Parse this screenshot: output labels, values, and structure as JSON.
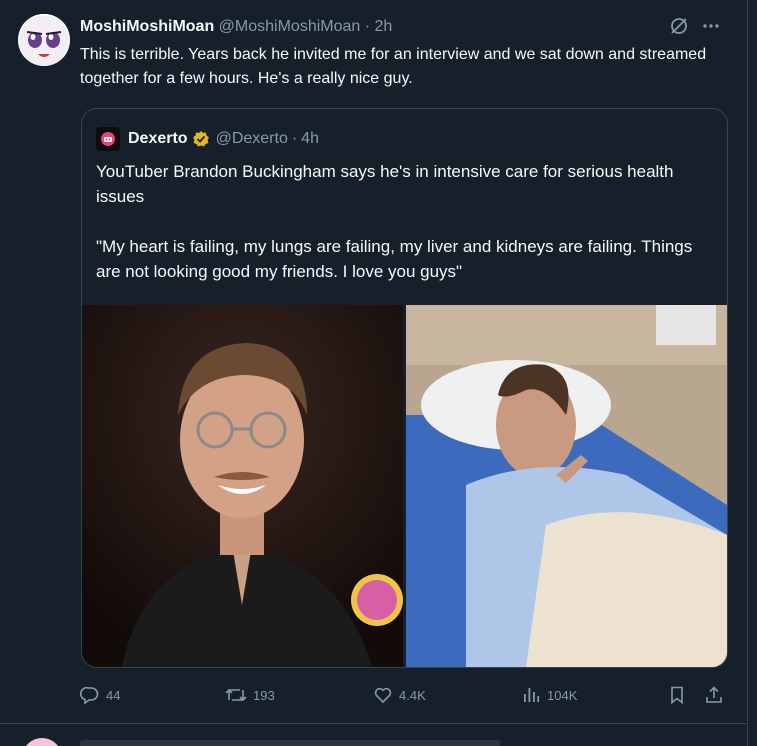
{
  "tweet": {
    "display_name": "MoshiMoshiMoan",
    "handle": "@MoshiMoshiMoan",
    "separator": "·",
    "time": "2h",
    "text": "This is terrible.  Years back he invited me for an interview and we sat down and streamed together for a few hours.  He's a really nice guy.",
    "more_icon": "more-horizontal-icon",
    "grok_icon": "grok-slash-icon"
  },
  "quote": {
    "display_name": "Dexerto",
    "handle": "@Dexerto",
    "separator": "·",
    "time": "4h",
    "verified_color": "#e8b425",
    "paragraph_1": "YouTuber Brandon Buckingham says he's in intensive care for serious health issues",
    "paragraph_2": "\"My heart is failing, my lungs are failing, my liver and kidneys are failing. Things are not looking good my friends. I love you guys\"",
    "media": [
      {
        "name": "portrait-photo",
        "description_icon": "photo"
      },
      {
        "name": "hospital-photo",
        "description_icon": "photo"
      }
    ]
  },
  "actions": {
    "replies": "44",
    "reposts": "193",
    "likes": "4.4K",
    "views": "104K"
  },
  "colors": {
    "background": "#15202b",
    "border": "#38444d",
    "text_primary": "#f7f9f9",
    "text_secondary": "#8b98a5"
  }
}
